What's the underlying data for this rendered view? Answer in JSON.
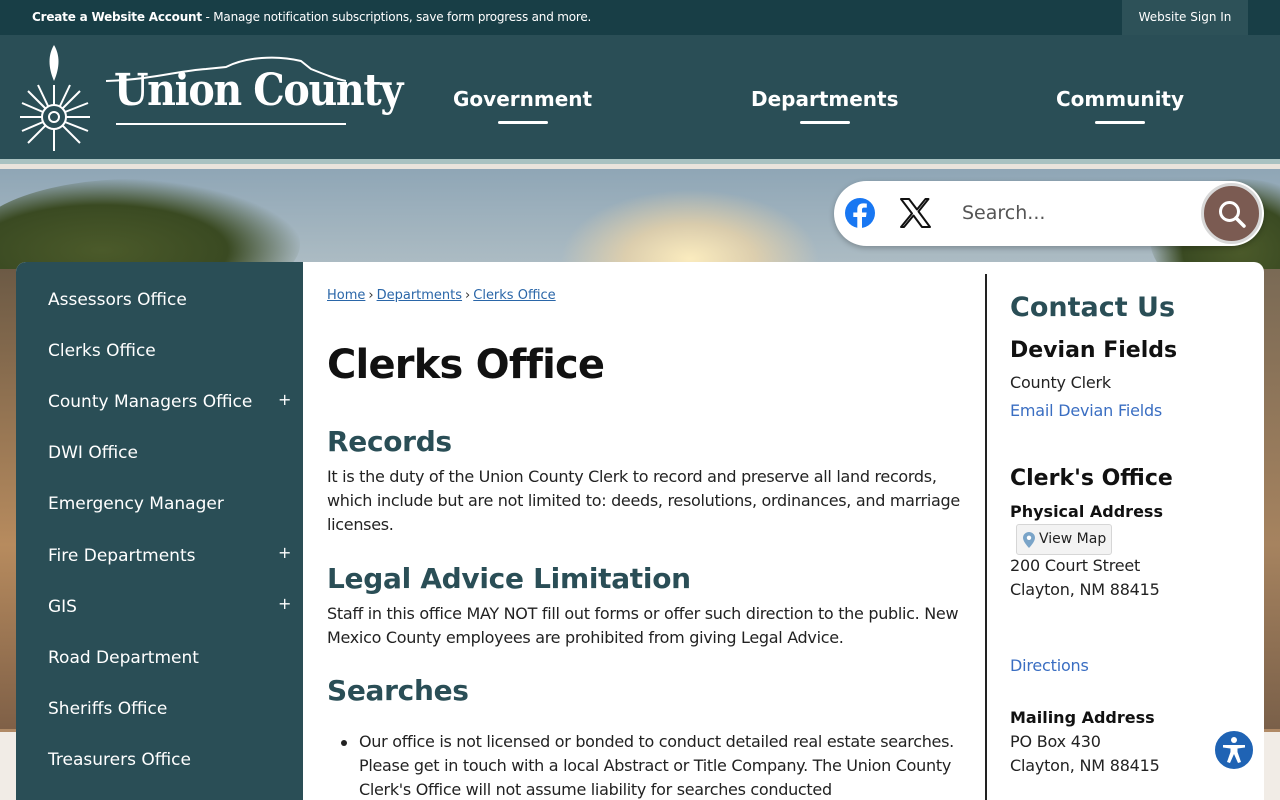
{
  "topbar": {
    "create_account": "Create a Website Account",
    "create_account_desc": " - Manage notification subscriptions, save form progress and more.",
    "sign_in": "Website Sign In"
  },
  "header": {
    "logo_text": "Union County",
    "nav": [
      "Government",
      "Departments",
      "Community"
    ]
  },
  "search": {
    "placeholder": "Search...",
    "social": [
      "facebook-icon",
      "x-icon"
    ]
  },
  "sidebar": {
    "items": [
      {
        "label": "Assessors Office",
        "expandable": false
      },
      {
        "label": "Clerks Office",
        "expandable": false
      },
      {
        "label": "County Managers Office",
        "expandable": true
      },
      {
        "label": "DWI Office",
        "expandable": false
      },
      {
        "label": "Emergency Manager",
        "expandable": false
      },
      {
        "label": "Fire Departments",
        "expandable": true
      },
      {
        "label": "GIS",
        "expandable": true
      },
      {
        "label": "Road Department",
        "expandable": false
      },
      {
        "label": "Sheriffs Office",
        "expandable": false
      },
      {
        "label": "Treasurers Office",
        "expandable": false
      }
    ],
    "expand_symbol": "+"
  },
  "breadcrumb": {
    "items": [
      "Home",
      "Departments",
      "Clerks Office"
    ],
    "separator": "›"
  },
  "main": {
    "title": "Clerks Office",
    "records_heading": "Records",
    "records_text": "It is the duty of the Union County Clerk to record and preserve all land records, which include but are not limited to: deeds, resolutions, ordinances, and marriage licenses.",
    "legal_heading": "Legal Advice Limitation",
    "legal_text": "Staff in this office MAY NOT fill out forms or offer such direction to the public. New Mexico County employees are prohibited from giving Legal Advice.",
    "searches_heading": "Searches",
    "searches_bullet": "Our office is not licensed or bonded to conduct detailed real estate searches. Please get in touch with a local Abstract or Title Company. The Union County Clerk's Office will not assume liability for searches conducted"
  },
  "contact": {
    "heading": "Contact Us",
    "person_name": "Devian Fields",
    "person_title": "County Clerk",
    "email_link": "Email Devian Fields",
    "office_name": "Clerk's Office",
    "physical_label": "Physical Address",
    "view_map": "View Map",
    "street": "200 Court Street",
    "city": "Clayton, NM 88415",
    "directions": "Directions",
    "mailing_label": "Mailing Address",
    "po_box": "PO Box 430",
    "mailing_city": "Clayton, NM 88415"
  },
  "colors": {
    "header_bg": "#2a4e56",
    "topbar_bg": "#183e46",
    "heading": "#2a4e56",
    "link": "#3a6ec2",
    "search_button": "#7b5b52",
    "accessibility": "#1f63b4"
  }
}
